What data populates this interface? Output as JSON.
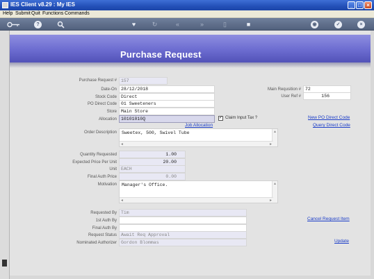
{
  "window": {
    "title": "IES Client v8.29 : My IES"
  },
  "menu": [
    "Help",
    "Submit",
    "Quit",
    "Functions",
    "Commands"
  ],
  "page": {
    "title": "Purchase Request"
  },
  "labels": {
    "purchase_request_no": "Purchase Request #",
    "date_on": "Date-On",
    "stock_code": "Stock Code",
    "po_direct_code": "PO Direct Code",
    "store": "Store",
    "allocation": "Allocation",
    "order_description": "Order Description",
    "quantity_requested": "Quantity Requested",
    "expected_price": "Expected Price Per Unit",
    "unit": "Unit",
    "final_auth_price": "Final Auth Price",
    "motivation": "Motivation",
    "requested_by": "Requested By",
    "first_auth_by": "1st Auth By",
    "final_auth_by": "Final Auth By",
    "request_status": "Request Status",
    "nominated_authorizer": "Nominated Authorizer",
    "main_requisition_no": "Main Requsition #",
    "user_ref_no": "User Ref #",
    "claim_input_tax": "Claim Input Tax ?"
  },
  "values": {
    "purchase_request_no": "157",
    "date_on": "28/12/2018",
    "stock_code": "Direct",
    "po_direct_code": "01 Sweeteners",
    "store": "Main Store",
    "allocation": "10101010Q",
    "order_description": "Sweetex, 500, Swivel Tube",
    "quantity_requested": "1.00",
    "expected_price": "20.00",
    "unit": "EACH",
    "final_auth_price": "0.00",
    "motivation": "Manager's Office.",
    "requested_by": "Tim",
    "first_auth_by": "",
    "final_auth_by": "",
    "request_status": "Await Req Approval",
    "nominated_authorizer": "Gordon Blommas",
    "main_requisition_no": "72",
    "user_ref_no": "156",
    "claim_input_tax_checked": true
  },
  "links": {
    "job_allocation": "Job Allocation",
    "new_po_direct_code": "New PO Direct Code",
    "query_direct_code": "Query Direct Code",
    "cancel_request_item": "Cancel Request Item",
    "update": "Update"
  },
  "colors": {
    "header_band": "#6c6cd0",
    "title_bar": "#2350b8",
    "link": "#1a3cc8"
  },
  "toolbar_icons": [
    "key-icon",
    "help-icon",
    "search-icon",
    "heart-icon",
    "refresh-icon",
    "rewind-icon",
    "fast-forward-icon",
    "bookmark-icon",
    "stop-icon",
    "globe-icon",
    "check-icon",
    "close-icon"
  ]
}
